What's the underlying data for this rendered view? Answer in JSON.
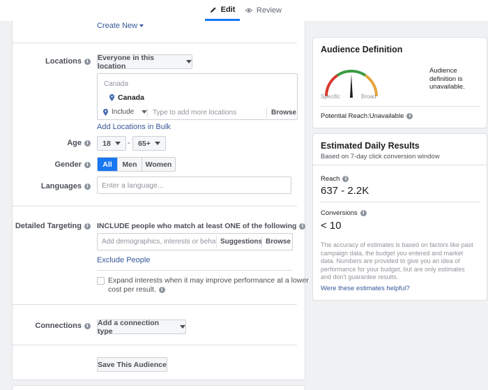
{
  "tabs": {
    "edit": "Edit",
    "review": "Review"
  },
  "create_new": "Create New",
  "locations": {
    "label": "Locations",
    "dropdown": "Everyone in this location",
    "country_header": "Canada",
    "selected": "Canada",
    "include": "Include",
    "placeholder": "Type to add more locations",
    "browse": "Browse",
    "add_bulk": "Add Locations in Bulk"
  },
  "age": {
    "label": "Age",
    "min": "18",
    "dash": "-",
    "max": "65+"
  },
  "gender": {
    "label": "Gender",
    "options": [
      "All",
      "Men",
      "Women"
    ],
    "selected": "All"
  },
  "languages": {
    "label": "Languages",
    "placeholder": "Enter a language..."
  },
  "detailed_targeting": {
    "label": "Detailed Targeting",
    "include_text": "INCLUDE people who match at least ONE of the following",
    "placeholder": "Add demographics, interests or behavio",
    "suggestions": "Suggestions",
    "browse": "Browse",
    "exclude": "Exclude People",
    "expand_text_1": "Expand interests when it may improve performance at a lower",
    "expand_text_2": "cost per result."
  },
  "connections": {
    "label": "Connections",
    "dropdown": "Add a connection type"
  },
  "save_audience": "Save This Audience",
  "audience_definition": {
    "title": "Audience Definition",
    "specific": "Specific",
    "broad": "Broad",
    "status_1": "Audience",
    "status_2": "definition is",
    "status_3": "unavailable.",
    "potential_reach": "Potential Reach:Unavailable"
  },
  "estimated": {
    "title": "Estimated Daily Results",
    "subtitle": "Based on 7-day click conversion window",
    "reach_label": "Reach",
    "reach_value": "637 - 2.2K",
    "conversions_label": "Conversions",
    "conversions_value": "< 10",
    "disclaimer": [
      "The accuracy of estimates is based on factors like past",
      "campaign data, the budget you entered and market",
      "data. Numbers are provided to give you an idea of",
      "performance for your budget, but are only estimates",
      "and don't guarantee results."
    ],
    "helpful_link": "Were these estimates helpful?"
  },
  "colors": {
    "accent": "#1877f2",
    "link": "#365899",
    "gauge_red": "#d6392c",
    "gauge_green": "#3a9b45",
    "gauge_orange": "#e7a53a"
  }
}
